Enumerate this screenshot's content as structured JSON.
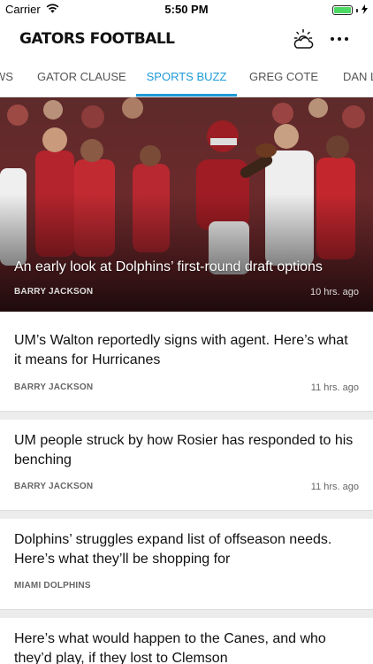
{
  "status_bar": {
    "carrier": "Carrier",
    "time": "5:50 PM",
    "battery_level": 1.0
  },
  "header": {
    "title": "GATORS FOOTBALL",
    "weather_icon": "weather-cloud-sun-icon",
    "more_icon": "more-dots-icon"
  },
  "tabs": [
    {
      "label": "WS"
    },
    {
      "label": "GATOR CLAUSE"
    },
    {
      "label": "SPORTS BUZZ",
      "active": true
    },
    {
      "label": "GREG COTE"
    },
    {
      "label": "DAN L"
    }
  ],
  "hero": {
    "title": "An early look at Dolphins’ first-round draft options",
    "author": "BARRY JACKSON",
    "time": "10 hrs. ago"
  },
  "stories": [
    {
      "title": "UM’s Walton reportedly signs with agent. Here’s what it means for Hurricanes",
      "author": "BARRY JACKSON",
      "time": "11 hrs. ago"
    },
    {
      "title": "UM people struck by how Rosier has responded to his benching",
      "author": "BARRY JACKSON",
      "time": "11 hrs. ago"
    },
    {
      "title": "Dolphins’ struggles expand list of offseason needs. Here’s what they’ll be shopping for",
      "author": "MIAMI DOLPHINS",
      "time": ""
    },
    {
      "title": "Here’s what would happen to the Canes, and who they’d play, if they lost to Clemson",
      "author": "",
      "time": ""
    }
  ],
  "colors": {
    "accent": "#1f9bd7",
    "battery": "#4cd964"
  }
}
